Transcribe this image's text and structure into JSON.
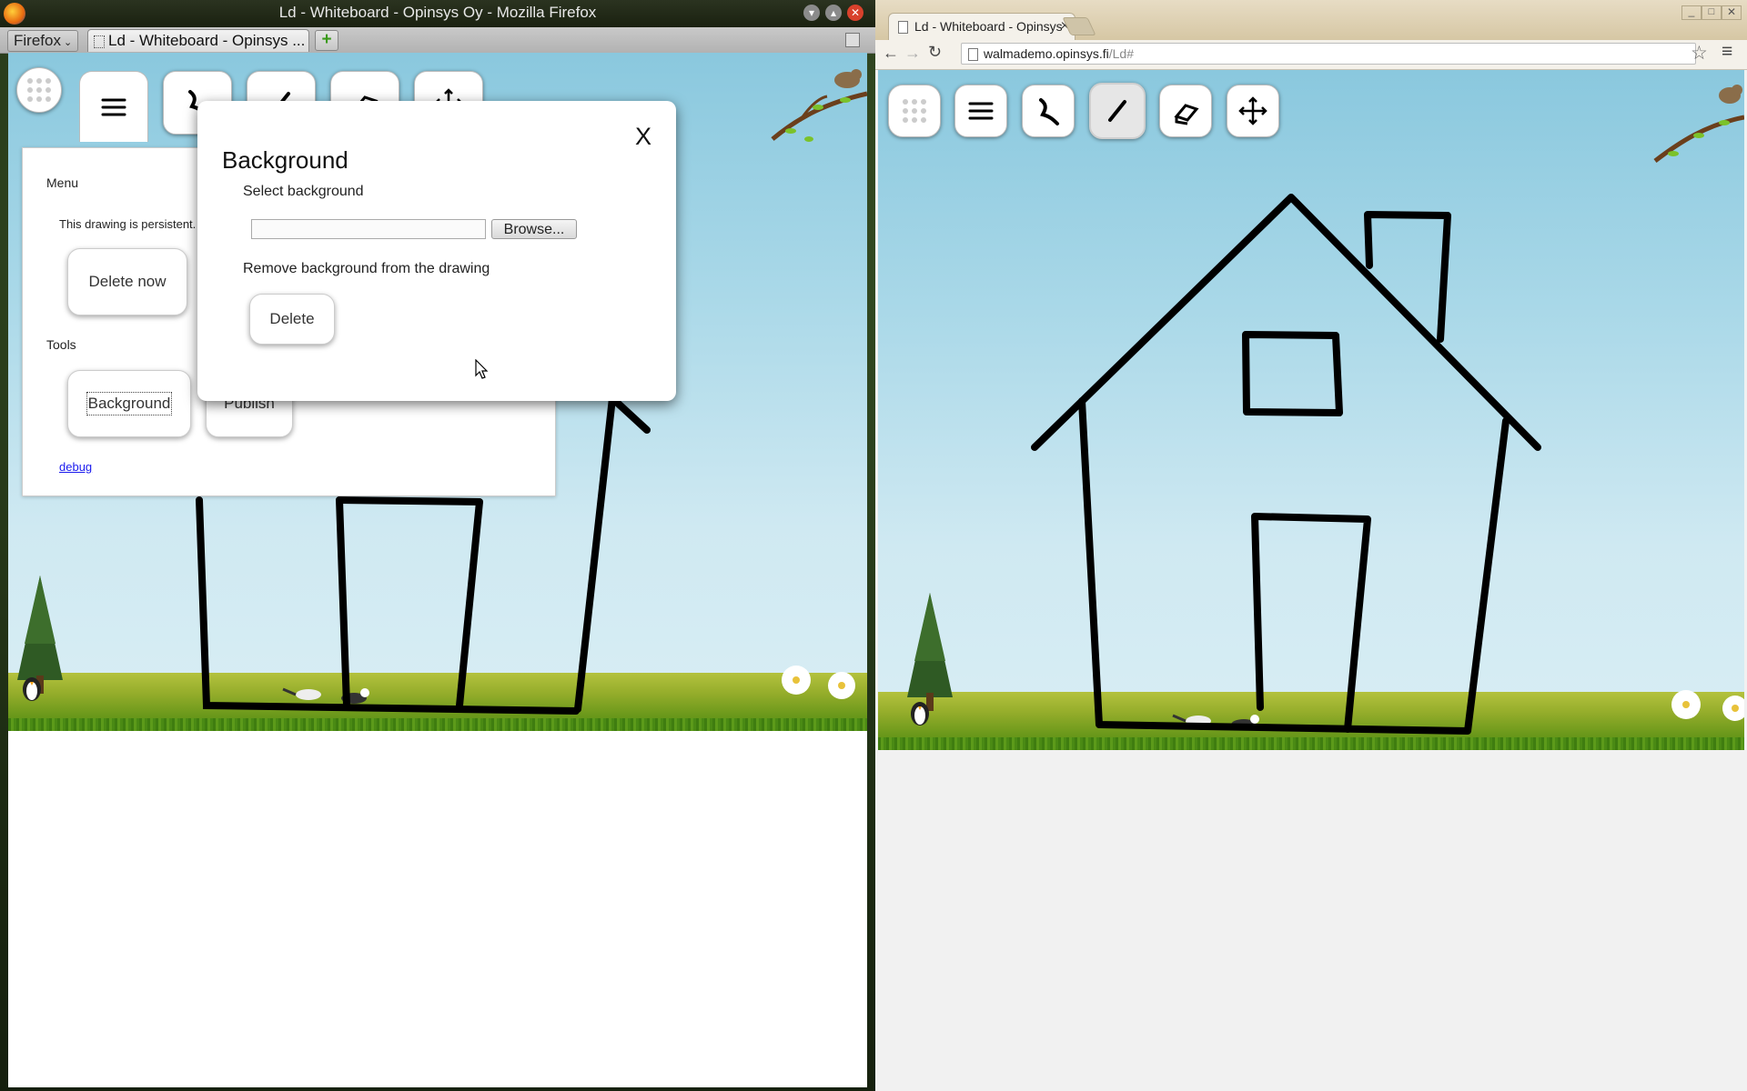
{
  "left_window": {
    "title": "Ld - Whiteboard - Opinsys Oy - Mozilla Firefox",
    "firefox_menu": "Firefox",
    "tab_title": "Ld - Whiteboard - Opinsys ...",
    "menu_panel": {
      "menu_heading": "Menu",
      "persistent_text": "This drawing is persistent.",
      "delete_now_button": "Delete now",
      "tools_heading": "Tools",
      "background_button": "Background",
      "publish_button": "Publish",
      "debug_link": "debug"
    },
    "dialog": {
      "title": "Background",
      "close": "X",
      "select_label": "Select background",
      "file_value": "",
      "browse_button": "Browse...",
      "remove_label": "Remove background from the drawing",
      "delete_button": "Delete"
    }
  },
  "right_window": {
    "tab_title": "Ld - Whiteboard - Opinsys",
    "tab_close": "×",
    "url_host": "walmademo.opinsys.fi",
    "url_path": "/Ld#",
    "toolbar": {
      "tools": [
        "app-grid",
        "menu",
        "freehand",
        "line",
        "eraser",
        "move"
      ],
      "active_tool": "line"
    }
  },
  "colors": {
    "sky": "#a9d8e8",
    "hill": "#95ad2b",
    "ink": "#000000",
    "chrome_frame": "#d6c7a4"
  }
}
